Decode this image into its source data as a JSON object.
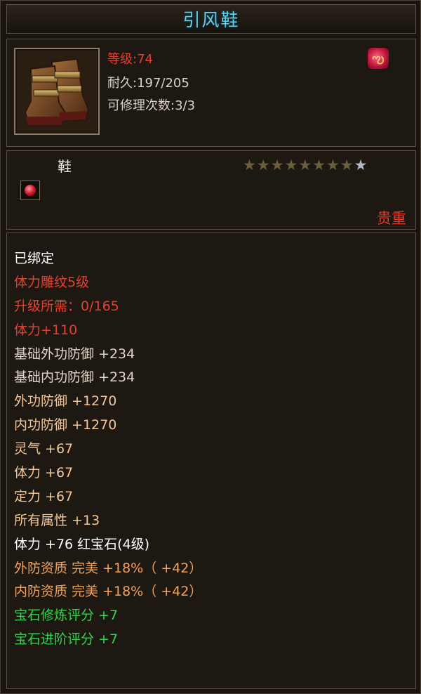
{
  "title": "引风鞋",
  "header": {
    "level_label": "等级",
    "level_sep": ":",
    "level_value": "74",
    "durability": "耐久:197/205",
    "repair_count": "可修理次数:3/3",
    "item_icon": "boots-icon",
    "badge_icon": "fire-rune-icon"
  },
  "type": {
    "label": "鞋",
    "stars_total": 9,
    "stars_filled": 8,
    "gem_icon": "red-gem-icon",
    "rarity": "贵重"
  },
  "attributes": [
    {
      "text": "已绑定",
      "color": "#ffffff"
    },
    {
      "text": "体力雕纹5级",
      "color": "#e8402e"
    },
    {
      "text": "升级所需：0/165",
      "color": "#e8402e"
    },
    {
      "text": "体力+110",
      "color": "#e8402e"
    },
    {
      "text": "基础外功防御 +234",
      "color": "#ded6c8"
    },
    {
      "text": "基础内功防御 +234",
      "color": "#ded6c8"
    },
    {
      "text": "外功防御 +1270",
      "color": "#f4c79a"
    },
    {
      "text": "内功防御 +1270",
      "color": "#f4c79a"
    },
    {
      "text": "灵气 +67",
      "color": "#f4c79a"
    },
    {
      "text": "体力 +67",
      "color": "#f4c79a"
    },
    {
      "text": "定力 +67",
      "color": "#f4c79a"
    },
    {
      "text": "所有属性 +13",
      "color": "#f4c79a"
    },
    {
      "text": "体力 +76 红宝石(4级)",
      "color": "#ffffff"
    },
    {
      "text": "外防资质  完美 +18%（ +42）",
      "color": "#f1a35a"
    },
    {
      "text": "内防资质  完美 +18%（ +42）",
      "color": "#f1a35a"
    },
    {
      "text": "宝石修炼评分 +7",
      "color": "#2fd64a"
    },
    {
      "text": "宝石进阶评分 +7",
      "color": "#2fd64a"
    }
  ]
}
